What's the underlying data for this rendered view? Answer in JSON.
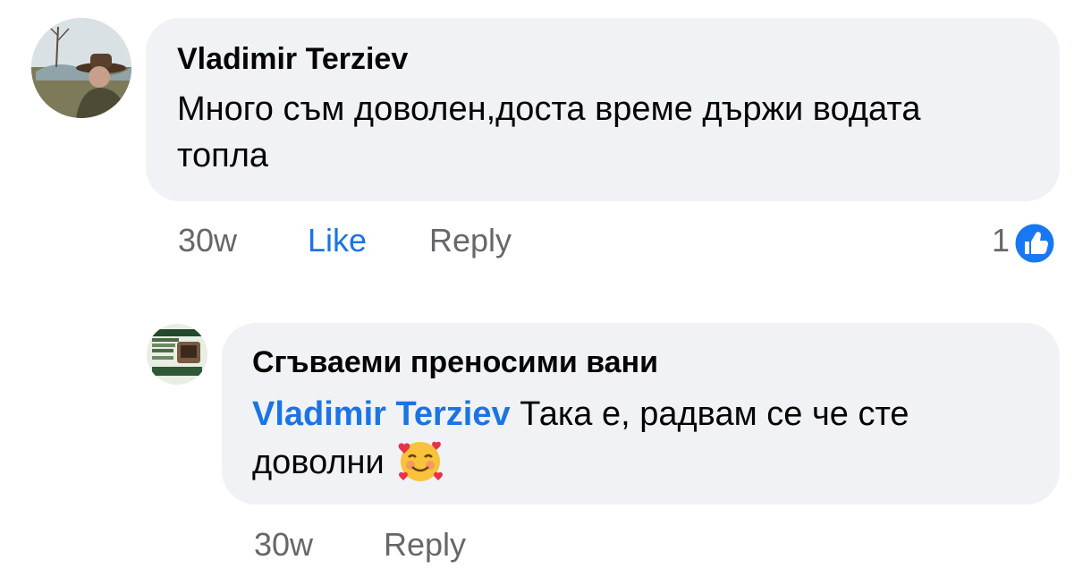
{
  "comment": {
    "author": "Vladimir Terziev",
    "text": "Много съм доволен,доста време държи водата топла",
    "time": "30w",
    "like_label": "Like",
    "reply_label": "Reply",
    "reaction_count": "1",
    "reaction_type": "like"
  },
  "reply": {
    "author": "Сгъваеми преносими вани",
    "mention": "Vladimir Terziev",
    "text": "Така е, радвам се че сте доволни",
    "emoji": "smiling-face-with-hearts",
    "time": "30w",
    "reply_label": "Reply"
  },
  "colors": {
    "link_blue": "#1b74e4",
    "bubble_bg": "#f0f2f5",
    "muted_text": "#65676b",
    "reaction_blue": "#1877f2"
  }
}
